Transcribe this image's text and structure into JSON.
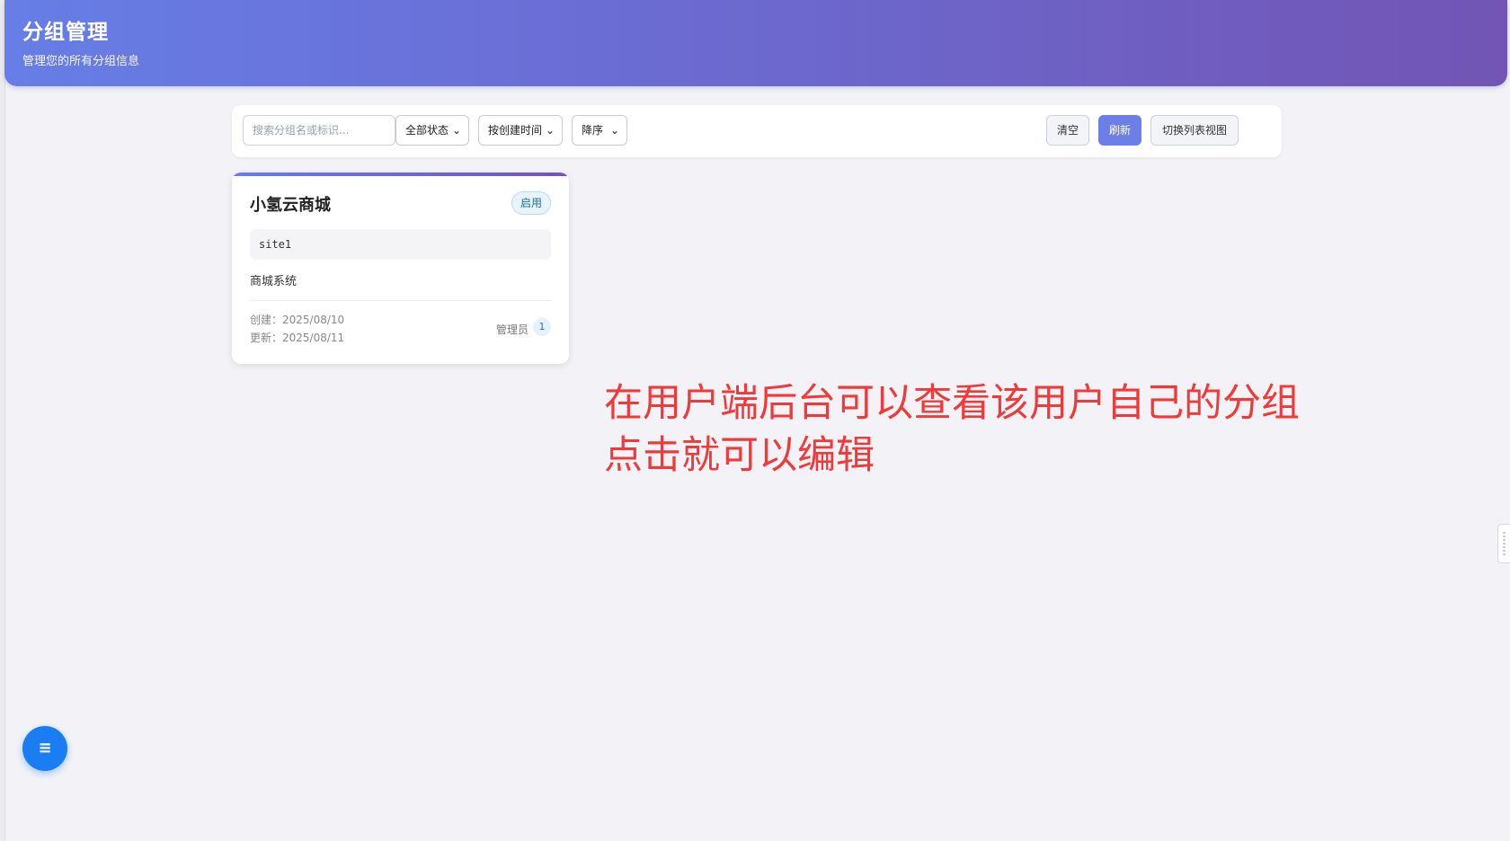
{
  "header": {
    "title": "分组管理",
    "subtitle": "管理您的所有分组信息"
  },
  "toolbar": {
    "search_placeholder": "搜索分组名或标识...",
    "status_filter": "全部状态",
    "sort_field": "按创建时间",
    "sort_order": "降序",
    "clear_label": "清空",
    "refresh_label": "刷新",
    "toggle_view_label": "切换列表视图"
  },
  "cards": [
    {
      "name": "小氢云商城",
      "status": "启用",
      "identifier": "site1",
      "description": "商城系统",
      "created_label": "创建：",
      "created": "2025/08/10",
      "updated_label": "更新：",
      "updated": "2025/08/11",
      "admin_label": "管理员",
      "admin_count": "1"
    }
  ],
  "annotation": {
    "line1": "在用户端后台可以查看该用户自己的分组",
    "line2": "点击就可以编辑"
  },
  "fab": {
    "icon": "menu-icon",
    "glyph": "≡"
  },
  "colors": {
    "header_gradient_start": "#667ee6",
    "header_gradient_end": "#7255b5",
    "primary": "#6b7fe6",
    "annotation": "#f03a3a",
    "fab": "#1a7ef2"
  }
}
